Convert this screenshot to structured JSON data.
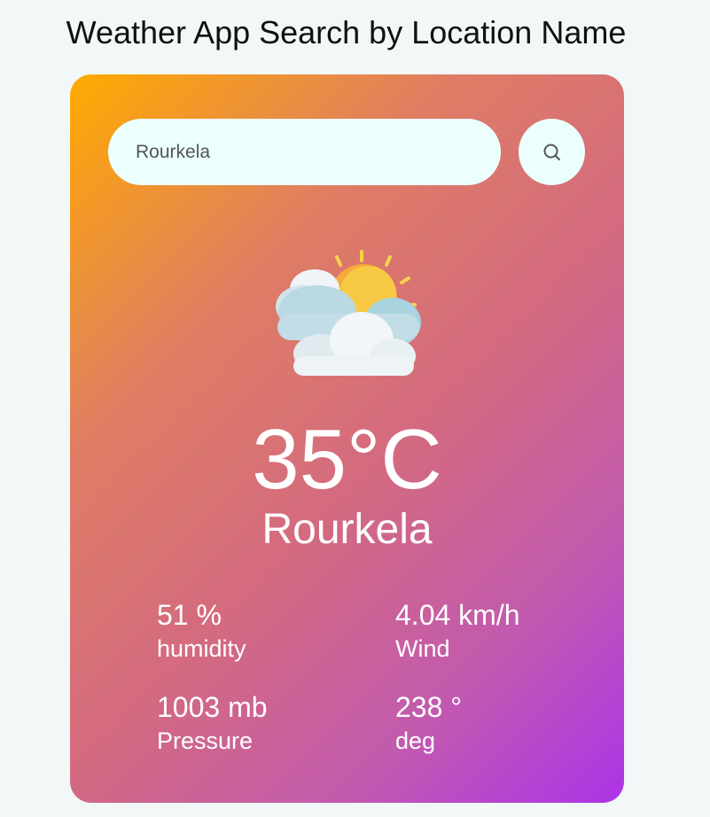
{
  "page": {
    "title": "Weather App Search by Location Name"
  },
  "search": {
    "value": "Rourkela",
    "button_icon": "search-icon"
  },
  "weather": {
    "icon": "partly-cloudy-icon",
    "temperature": "35°C",
    "city": "Rourkela"
  },
  "details": {
    "humidity": {
      "value": "51 %",
      "label": "humidity"
    },
    "wind": {
      "value": "4.04 km/h",
      "label": "Wind"
    },
    "pressure": {
      "value": "1003 mb",
      "label": "Pressure"
    },
    "direction": {
      "value": "238 °",
      "label": "deg"
    }
  },
  "colors": {
    "background": "#f2f7f8",
    "gradient_start": "#ffab00",
    "gradient_end": "#ad33e8",
    "search_fill": "#ebfffc"
  }
}
